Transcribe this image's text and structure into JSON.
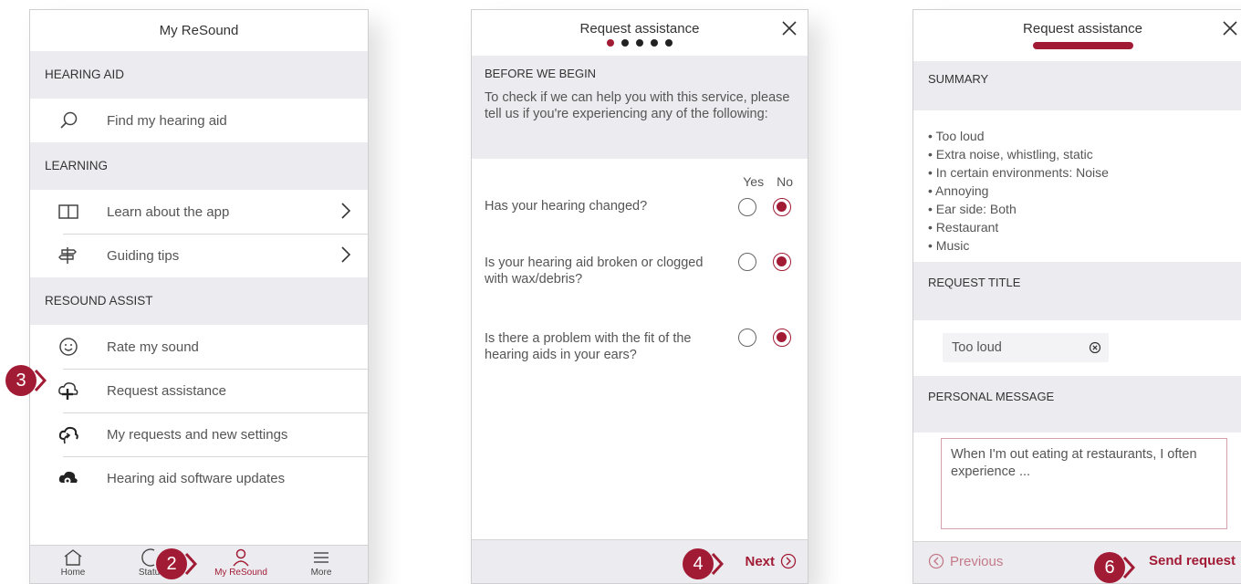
{
  "screen1": {
    "title": "My ReSound",
    "sections": [
      {
        "label": "HEARING AID",
        "items": [
          {
            "label": "Find my hearing aid",
            "icon": "search-icon"
          }
        ]
      },
      {
        "label": "LEARNING",
        "items": [
          {
            "label": "Learn about the app",
            "icon": "book-icon"
          },
          {
            "label": "Guiding tips",
            "icon": "signpost-icon"
          }
        ]
      },
      {
        "label": "RESOUND ASSIST",
        "items": [
          {
            "label": "Rate my sound",
            "icon": "smiley-icon"
          },
          {
            "label": "Request assistance",
            "icon": "cloud-plus-icon"
          },
          {
            "label": "My requests and new settings",
            "icon": "cloud-arrow-icon"
          },
          {
            "label": "Hearing aid software updates",
            "icon": "cloud-gear-icon"
          }
        ]
      }
    ],
    "tabs": [
      {
        "label": "Home"
      },
      {
        "label": "Status"
      },
      {
        "label": "My ReSound"
      },
      {
        "label": "More"
      }
    ],
    "badges": [
      "3",
      "2"
    ]
  },
  "screen2": {
    "title": "Request assistance",
    "progress_current": 1,
    "progress_total": 5,
    "heading": "BEFORE WE BEGIN",
    "intro": "To check if we can help you with this service, please tell us if you're experiencing any of the following:",
    "yes_label": "Yes",
    "no_label": "No",
    "questions": [
      {
        "text": "Has your hearing changed?",
        "answer": "No"
      },
      {
        "text": "Is your hearing aid broken or clogged with wax/debris?",
        "answer": "No"
      },
      {
        "text": "Is there a problem with the fit of the hearing aids in your ears?",
        "answer": "No"
      }
    ],
    "next_label": "Next",
    "badge": "4"
  },
  "screen3": {
    "title": "Request assistance",
    "summary_heading": "SUMMARY",
    "summary_items": [
      "Too loud",
      "Extra noise, whistling, static",
      "In certain environments: Noise",
      "Annoying",
      "Ear side: Both",
      "Restaurant",
      "Music"
    ],
    "request_title_heading": "REQUEST TITLE",
    "request_title_value": "Too loud",
    "personal_message_heading": "PERSONAL MESSAGE",
    "personal_message_value": "When I'm out eating at restaurants, I often experience ...",
    "previous_label": "Previous",
    "send_label": "Send request",
    "badge": "6"
  },
  "colors": {
    "accent": "#a21b35",
    "section_bg": "#ececf0"
  }
}
